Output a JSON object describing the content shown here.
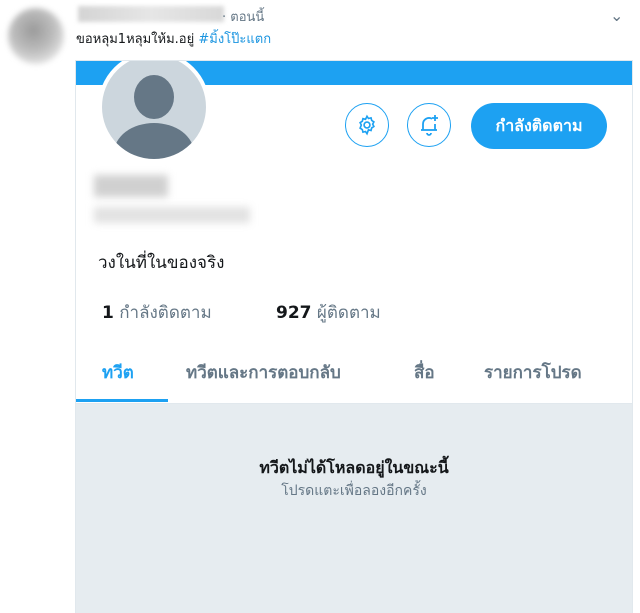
{
  "tweet": {
    "time": "· ตอนนี้",
    "text": "ขอหลุม1หลุมให้ม.อยู่ ",
    "hashtag": "#มิ้งโป๊ะแตก"
  },
  "profile": {
    "bio": "วงในที่ในของจริง",
    "following_count": "1",
    "following_label": "กำลังติดตาม",
    "followers_count": "927",
    "followers_label": "ผู้ติดตาม",
    "follow_button_label": "กำลังติดตาม"
  },
  "tabs": [
    {
      "label": "ทวีต"
    },
    {
      "label": "ทวีตและการตอบกลับ"
    },
    {
      "label": "สื่อ"
    },
    {
      "label": "รายการโปรด"
    }
  ],
  "empty_state": {
    "title": "ทวีตไม่ได้โหลดอยู่ในขณะนี้",
    "subtitle": "โปรดแตะเพื่อลองอีกครั้ง"
  },
  "colors": {
    "accent": "#1da1f2",
    "hashtag": "#1b95e0",
    "muted": "#657786",
    "empty_bg": "#e6ecf0"
  },
  "icons": [
    "gear-icon",
    "bell-plus-icon",
    "chevron-down-icon"
  ]
}
